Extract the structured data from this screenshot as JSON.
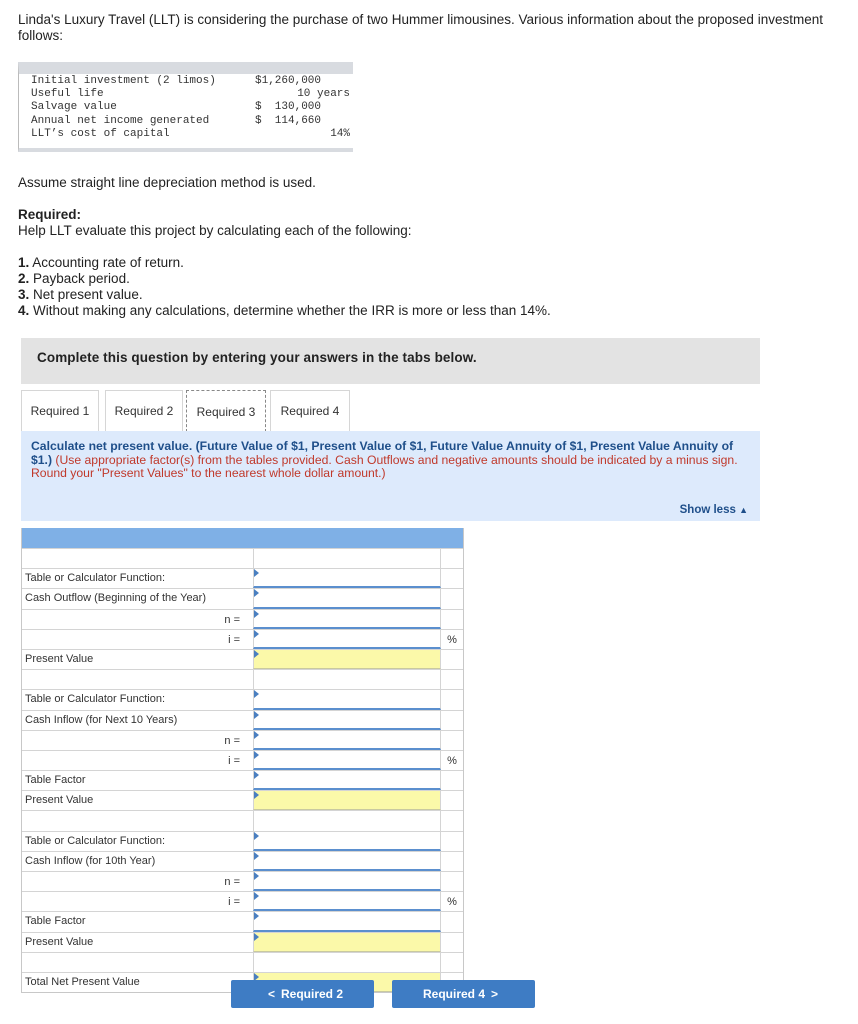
{
  "intro": "Linda's Luxury Travel (LLT) is considering the purchase of two Hummer limousines. Various information about the proposed investment follows:",
  "investment_table": [
    {
      "label": "Initial investment (2 limos)",
      "value": "$1,260,000",
      "align": "left"
    },
    {
      "label": "Useful life",
      "value": "10 years",
      "align": "right"
    },
    {
      "label": "Salvage value",
      "value": "$  130,000",
      "align": "left"
    },
    {
      "label": "Annual net income generated",
      "value": "$  114,660",
      "align": "left"
    },
    {
      "label": "LLT’s cost of capital",
      "value": "14%",
      "align": "right"
    }
  ],
  "assume": "Assume straight line depreciation method is used.",
  "required_heading": "Required:",
  "required_intro": "Help LLT evaluate this project by calculating each of the following:",
  "required_list": [
    {
      "num": "1.",
      "text": " Accounting rate of return."
    },
    {
      "num": "2.",
      "text": " Payback period."
    },
    {
      "num": "3.",
      "text": " Net present value."
    },
    {
      "num": "4.",
      "text": " Without making any calculations, determine whether the IRR is more or less than 14%."
    }
  ],
  "complete_instruction": "Complete this question by entering your answers in the tabs below.",
  "tabs": [
    {
      "label": "Required 1"
    },
    {
      "label": "Required 2"
    },
    {
      "label": "Required 3"
    },
    {
      "label": "Required 4"
    }
  ],
  "active_tab": "Required 3",
  "instructions": {
    "lead": "Calculate net present value. ",
    "factors": "(Future Value of $1, Present Value of $1, Future Value Annuity of $1, Present Value Annuity of $1.)",
    "note": " (Use appropriate factor(s) from the tables provided. Cash Outflows and negative amounts should be indicated by a minus sign. Round your \"Present Values\" to the nearest whole dollar amount.)"
  },
  "show_less": "Show less",
  "grid_rows": [
    {
      "label": "",
      "ni": "",
      "cell": "none",
      "unit": ""
    },
    {
      "label": "Table or Calculator Function:",
      "ni": "",
      "cell": "input",
      "unit": ""
    },
    {
      "label": "Cash Outflow (Beginning of the Year)",
      "ni": "",
      "cell": "input",
      "unit": ""
    },
    {
      "label": "",
      "ni": "n =",
      "cell": "input",
      "unit": ""
    },
    {
      "label": "",
      "ni": "i =",
      "cell": "input",
      "unit": "%"
    },
    {
      "label": "Present Value",
      "ni": "",
      "cell": "yellow",
      "unit": ""
    },
    {
      "label": "",
      "ni": "",
      "cell": "none",
      "unit": ""
    },
    {
      "label": "Table or Calculator Function:",
      "ni": "",
      "cell": "input",
      "unit": ""
    },
    {
      "label": "Cash Inflow (for Next 10 Years)",
      "ni": "",
      "cell": "input",
      "unit": ""
    },
    {
      "label": "",
      "ni": "n =",
      "cell": "input",
      "unit": ""
    },
    {
      "label": "",
      "ni": "i =",
      "cell": "input",
      "unit": "%"
    },
    {
      "label": "Table Factor",
      "ni": "",
      "cell": "input",
      "unit": ""
    },
    {
      "label": "Present Value",
      "ni": "",
      "cell": "yellow",
      "unit": ""
    },
    {
      "label": "",
      "ni": "",
      "cell": "none",
      "unit": ""
    },
    {
      "label": "Table or Calculator Function:",
      "ni": "",
      "cell": "input",
      "unit": ""
    },
    {
      "label": "Cash Inflow (for 10th Year)",
      "ni": "",
      "cell": "input",
      "unit": ""
    },
    {
      "label": "",
      "ni": "n =",
      "cell": "input",
      "unit": ""
    },
    {
      "label": "",
      "ni": "i =",
      "cell": "input",
      "unit": "%"
    },
    {
      "label": "Table Factor",
      "ni": "",
      "cell": "input",
      "unit": ""
    },
    {
      "label": "Present Value",
      "ni": "",
      "cell": "yellow",
      "unit": ""
    },
    {
      "label": "",
      "ni": "",
      "cell": "none",
      "unit": ""
    },
    {
      "label": "Total Net Present Value",
      "ni": "",
      "cell": "yellow",
      "unit": ""
    }
  ],
  "nav": {
    "prev": "Required 2",
    "next": "Required 4"
  }
}
